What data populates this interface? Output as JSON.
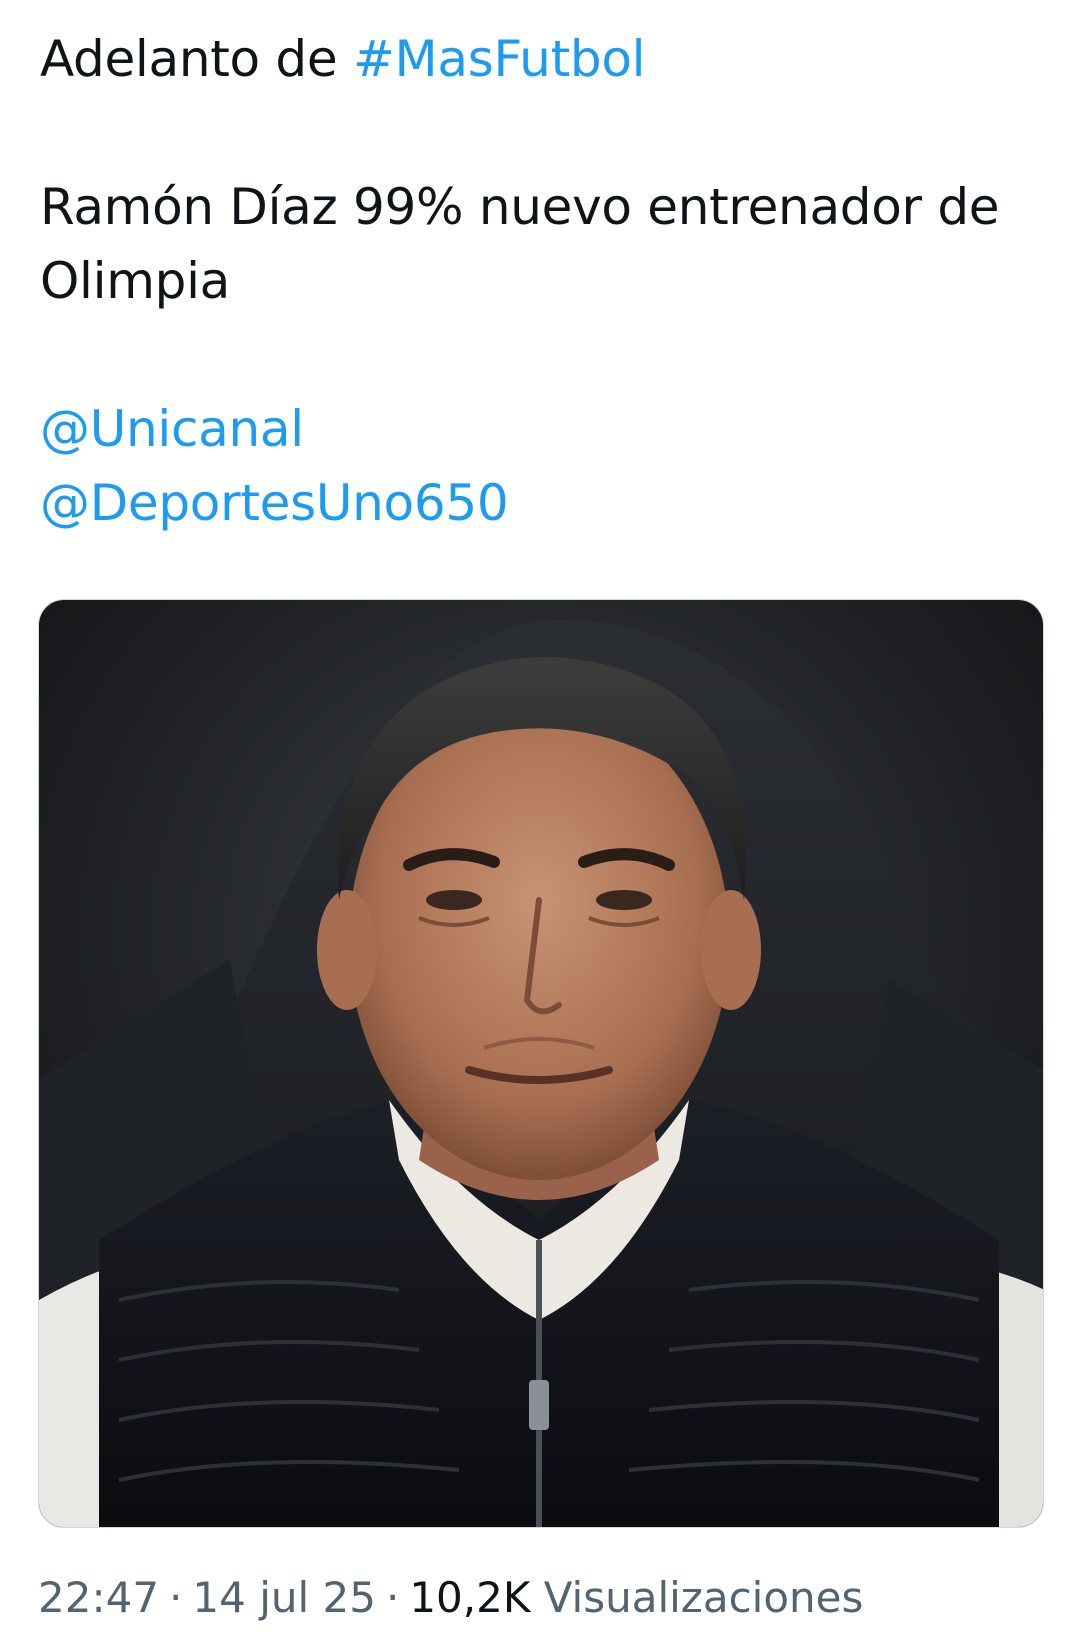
{
  "tweet": {
    "line1_prefix": "Adelanto de ",
    "hashtag": "#MasFutbol",
    "line2": "Ramón Díaz 99% nuevo entrenador de",
    "line3": "Olimpia",
    "mention1": "@Unicanal",
    "mention2": "@DeportesUno650"
  },
  "media": {
    "kind": "photo"
  },
  "meta": {
    "time": "22:47",
    "date": "14 jul 25",
    "views_count": "10,2K",
    "views_label": "Visualizaciones"
  },
  "colors": {
    "link": "#1d9bf0",
    "text": "#0f1419",
    "secondary": "#536471"
  }
}
